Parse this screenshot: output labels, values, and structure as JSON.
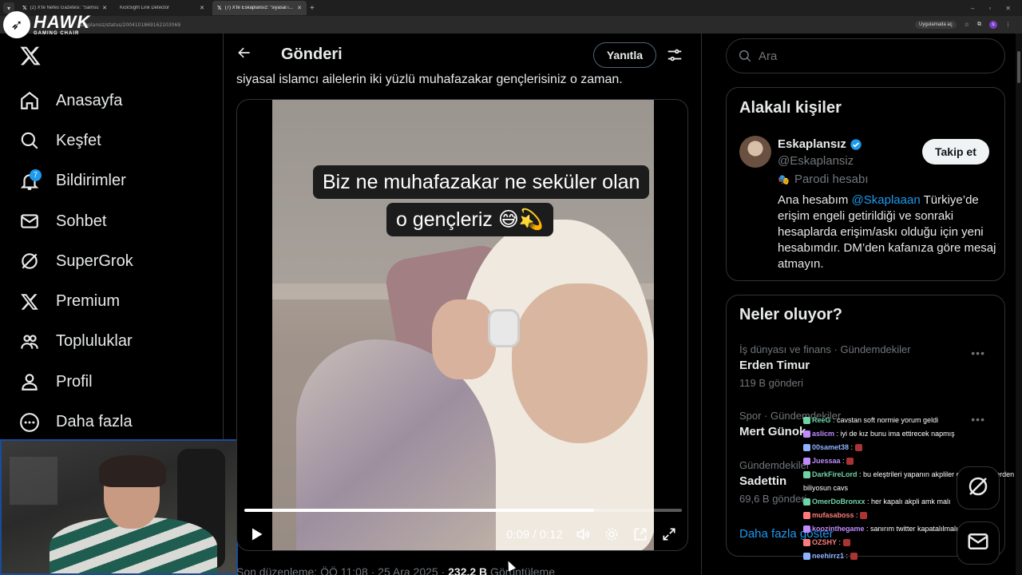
{
  "browser": {
    "tabs": [
      {
        "title": "(2) X'te Nefes Gazetesi: \"Samsu",
        "active": false
      },
      {
        "title": "KickSight Link Detector",
        "active": false
      },
      {
        "title": "(7) X'te Eskaplansız: \"siyasal isla",
        "active": true
      }
    ],
    "url": "skaplansiz/status/2004101869162103069",
    "open_app_label": "Uygulamada aç",
    "profile_initial": "s"
  },
  "overlay_logo": {
    "name": "HAWK",
    "sub": "GAMING CHAIR"
  },
  "nav": {
    "items": [
      {
        "label": "Anasayfa",
        "icon": "home-icon"
      },
      {
        "label": "Keşfet",
        "icon": "search-icon"
      },
      {
        "label": "Bildirimler",
        "icon": "bell-icon",
        "badge": "7"
      },
      {
        "label": "Sohbet",
        "icon": "mail-icon"
      },
      {
        "label": "SuperGrok",
        "icon": "grok-icon"
      },
      {
        "label": "Premium",
        "icon": "x-icon"
      },
      {
        "label": "Topluluklar",
        "icon": "communities-icon"
      },
      {
        "label": "Profil",
        "icon": "person-icon"
      },
      {
        "label": "Daha fazla",
        "icon": "more-icon"
      }
    ]
  },
  "post": {
    "header_title": "Gönderi",
    "reply_label": "Yanıtla",
    "text_line": "siyasal islamcı ailelerin iki yüzlü muhafazakar gençlerisiniz o zaman.",
    "video": {
      "caption_line1": "Biz ne muhafazakar ne seküler olan",
      "caption_line2": "o gençleriz 😅💫",
      "current_time": "0:09",
      "duration": "0:12",
      "progress": 0.8
    },
    "edited_prefix": "Son düzenleme: ÖÖ 11:08 · 25 Ara 2025 · ",
    "views_count": "232,2 B",
    "views_label": " Görüntüleme"
  },
  "sidebar": {
    "search_placeholder": "Ara",
    "related_title": "Alakalı kişiler",
    "person": {
      "name": "Eskaplansız",
      "handle": "@Eskaplansiz",
      "parody_label": "Parodi hesabı",
      "follow_label": "Takip et",
      "bio_before": "Ana hesabım ",
      "bio_mention": "@Skaplaaan",
      "bio_after": " Türkiye’de erişim engeli getirildiği ve sonraki hesaplarda erişim/askı olduğu için yeni hesabımdır. DM’den kafanıza göre mesaj atmayın."
    },
    "trends_title": "Neler oluyor?",
    "trends": [
      {
        "meta": "İş dünyası ve finans · Gündemdekiler",
        "name": "Erden Timur",
        "count": "119 B gönderi"
      },
      {
        "meta": "Spor · Gündemdekiler",
        "name": "Mert Günok",
        "count": ""
      },
      {
        "meta": "Gündemdekiler",
        "name": "Sadettin",
        "count": "69,6 B gönderi"
      }
    ],
    "show_more": "Daha fazla göster"
  },
  "chat": [
    {
      "user": "ReeG",
      "color": "#6fd3a8",
      "text": " : cavstan soft normie yorum geldi"
    },
    {
      "user": "aslicm",
      "color": "#c08bff",
      "text": " : iyi de kız bunu ima ettirecek napmış"
    },
    {
      "user": "00samet38",
      "color": "#8fb3ff",
      "text": " : "
    },
    {
      "user": "Juessaa",
      "color": "#c08bff",
      "text": " : "
    },
    {
      "user": "DarkFireLord",
      "color": "#6fd3a8",
      "text": " : bu eleştrileri yapanın akpliler olmadığını nerden biliyosun cavs"
    },
    {
      "user": "OmerDoBronxx",
      "color": "#6fd3a8",
      "text": " : her kapalı akpli amk malı"
    },
    {
      "user": "mufasaboss",
      "color": "#ff7b7b",
      "text": " : "
    },
    {
      "user": "koozinthegame",
      "color": "#c08bff",
      "text": " : sanırım twitter kapatalılmalı ya"
    },
    {
      "user": "OZSHY",
      "color": "#ff7b7b",
      "text": " : "
    },
    {
      "user": "neehirrz1",
      "color": "#8fb3ff",
      "text": " : "
    }
  ]
}
